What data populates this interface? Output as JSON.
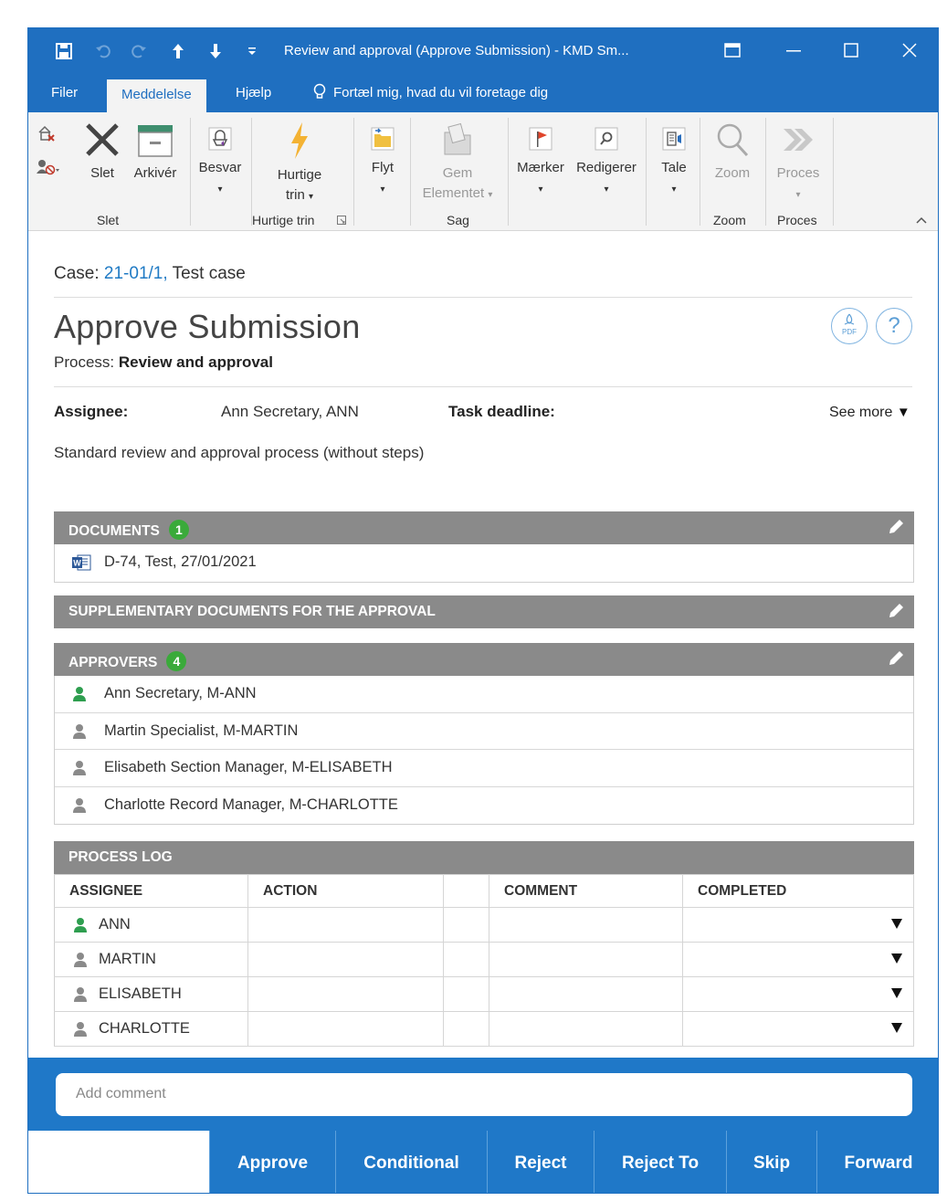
{
  "titlebar": {
    "title": "Review and approval (Approve Submission)  -  KMD Sm..."
  },
  "tabs": {
    "file": "Filer",
    "message": "Meddelelse",
    "help": "Hjælp",
    "tell_me": "Fortæl mig, hvad du vil foretage dig"
  },
  "ribbon": {
    "delete": "Slet",
    "archive": "Arkivér",
    "reply": "Besvar",
    "quick_steps": "Hurtige",
    "quick_steps_2": "trin",
    "move": "Flyt",
    "save_item": "Gem",
    "save_item_2": "Elementet",
    "tags": "Mærker",
    "editing": "Redigerer",
    "speech": "Tale",
    "zoom": "Zoom",
    "process": "Proces",
    "groups": {
      "delete": "Slet",
      "quick_steps": "Hurtige trin",
      "case": "Sag",
      "zoom": "Zoom",
      "process": "Proces"
    }
  },
  "task": {
    "case_label": "Case:",
    "case_link": "21-01/1,",
    "case_name": "Test case",
    "title": "Approve Submission",
    "process_label": "Process:",
    "process_name": "Review and approval",
    "pdf_label": "PDF",
    "help_label": "?",
    "assignee_label": "Assignee:",
    "assignee_value": "Ann Secretary, ANN",
    "deadline_label": "Task deadline:",
    "see_more": "See more",
    "description": "Standard review and approval process (without steps)"
  },
  "documents": {
    "header": "DOCUMENTS",
    "count": "1",
    "items": [
      "D-74, Test, 27/01/2021"
    ],
    "word_icon_label": "W"
  },
  "supplementary": {
    "header": "SUPPLEMENTARY DOCUMENTS FOR THE APPROVAL"
  },
  "approvers": {
    "header": "APPROVERS",
    "count": "4",
    "items": [
      {
        "name": "Ann Secretary, M-ANN",
        "active": true
      },
      {
        "name": "Martin Specialist, M-MARTIN",
        "active": false
      },
      {
        "name": "Elisabeth Section Manager, M-ELISABETH",
        "active": false
      },
      {
        "name": "Charlotte Record Manager, M-CHARLOTTE",
        "active": false
      }
    ]
  },
  "process_log": {
    "header": "PROCESS LOG",
    "columns": [
      "ASSIGNEE",
      "ACTION",
      "",
      "COMMENT",
      "COMPLETED"
    ],
    "rows": [
      {
        "assignee": "ANN",
        "active": true
      },
      {
        "assignee": "MARTIN",
        "active": false
      },
      {
        "assignee": "ELISABETH",
        "active": false
      },
      {
        "assignee": "CHARLOTTE",
        "active": false
      }
    ]
  },
  "comment": {
    "placeholder": "Add comment"
  },
  "actions": {
    "approve": "Approve",
    "conditional": "Conditional",
    "reject": "Reject",
    "reject_to": "Reject To",
    "skip": "Skip",
    "forward": "Forward"
  },
  "colors": {
    "accent": "#1f6fc0",
    "active_person": "#2e9e4f",
    "inactive_person": "#8a8a8a",
    "section_bar": "#8a8a8a",
    "badge": "#3aaa3a"
  }
}
